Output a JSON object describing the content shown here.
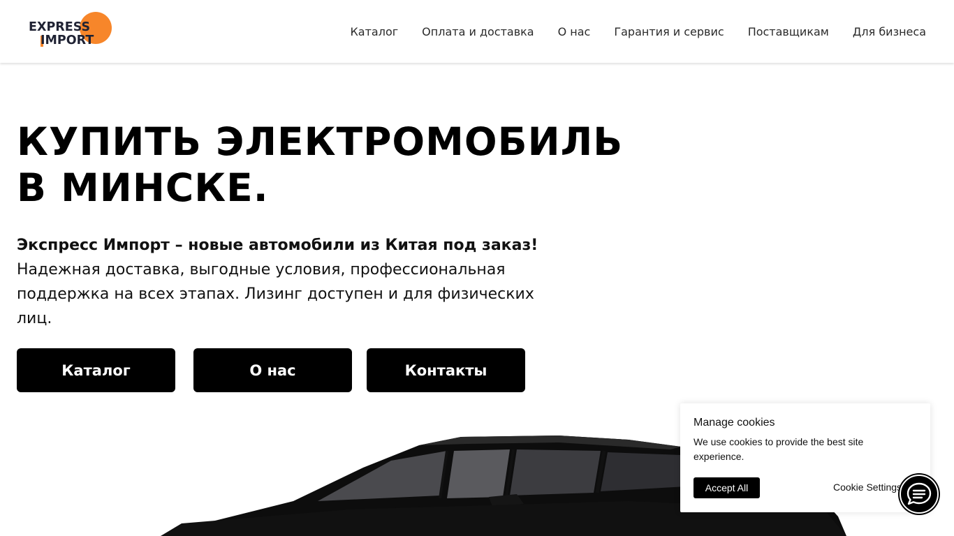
{
  "logo": {
    "line1": "EXPRESS",
    "line2": "IMPORT",
    "accent_color": "#f7862a"
  },
  "nav": {
    "items": [
      {
        "label": "Каталог"
      },
      {
        "label": "Оплата и доставка"
      },
      {
        "label": "О нас"
      },
      {
        "label": "Гарантия и сервис"
      },
      {
        "label": "Поставщикам"
      },
      {
        "label": "Для бизнеса"
      }
    ]
  },
  "hero": {
    "title_line1": "КУПИТЬ ЭЛЕКТРОМОБИЛЬ",
    "title_line2": "В МИНСКЕ.",
    "lead": "Экспресс Импорт – новые автомобили из Китая под заказ!",
    "description": "Надежная доставка, выгодные условия, профессиональная поддержка на всех этапах. Лизинг доступен и для физических лиц.",
    "buttons": [
      {
        "label": "Каталог"
      },
      {
        "label": "О нас"
      },
      {
        "label": "Контакты"
      }
    ]
  },
  "cookies": {
    "title": "Manage cookies",
    "text": "We use cookies to provide the best site experience.",
    "accept_label": "Accept All",
    "settings_label": "Cookie Settings"
  },
  "icons": {
    "chat": "chat-bubble-icon"
  }
}
